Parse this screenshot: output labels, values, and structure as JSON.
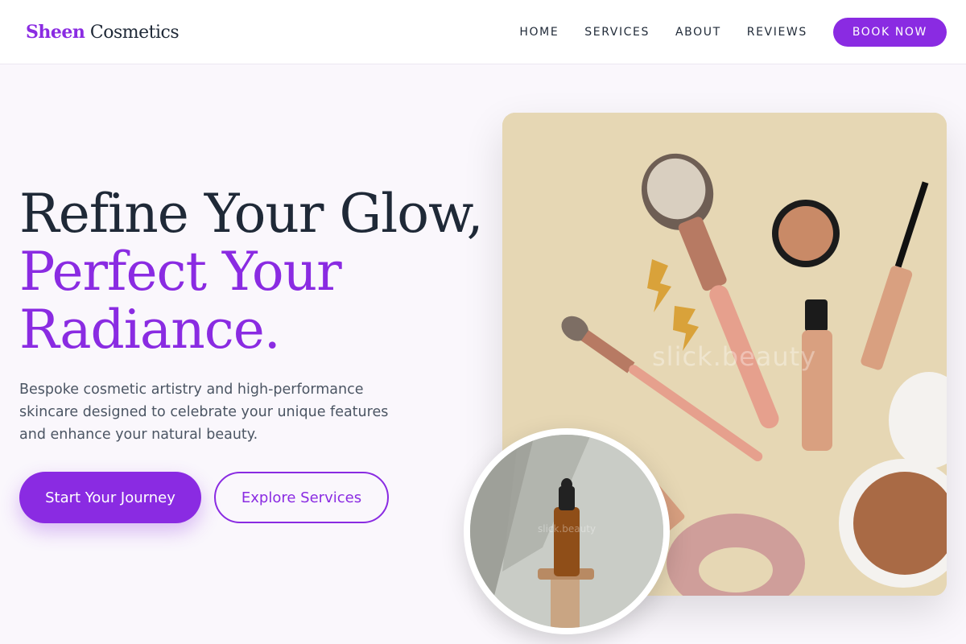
{
  "header": {
    "logo_brand": "Sheen",
    "logo_rest": " Cosmetics",
    "nav": [
      {
        "label": "HOME"
      },
      {
        "label": "SERVICES"
      },
      {
        "label": "ABOUT"
      },
      {
        "label": "REVIEWS"
      }
    ],
    "cta_label": "BOOK NOW"
  },
  "hero": {
    "headline_line1": "Refine Your Glow,",
    "headline_line2": "Perfect Your",
    "headline_line3": "Radiance.",
    "subtext": "Bespoke cosmetic artistry and high-performance skincare designed to celebrate your unique features and enhance your natural beauty.",
    "primary_button": "Start Your Journey",
    "secondary_button": "Explore Services",
    "main_image_watermark": "slick.beauty",
    "circle_image_watermark": "slick.beauty"
  },
  "colors": {
    "accent": "#8a2be2",
    "text_dark": "#1f2937",
    "text_muted": "#4b5563",
    "background": "#faf7fc",
    "image_background": "#e6d7b4"
  }
}
